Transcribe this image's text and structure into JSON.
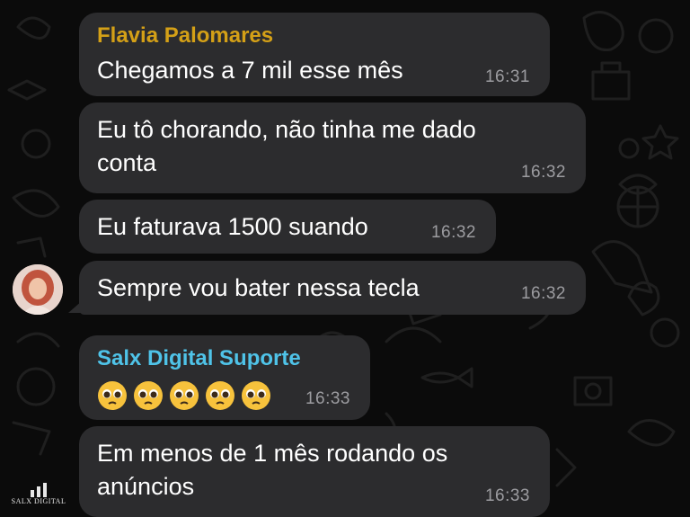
{
  "colors": {
    "background": "#0b0b0b",
    "bubble": "#2c2c2e",
    "sender_flavia": "#d4a017",
    "sender_salx": "#4fc3e8",
    "timestamp": "#9c9ca0"
  },
  "messages": [
    {
      "sender": "Flavia Palomares",
      "text": "Chegamos a 7 mil esse mês",
      "time": "16:31"
    },
    {
      "text": "Eu tô chorando, não tinha me dado\nconta",
      "time": "16:32"
    },
    {
      "text": "Eu faturava 1500 suando",
      "time": "16:32"
    },
    {
      "text": "Sempre vou bater nessa tecla",
      "time": "16:32"
    },
    {
      "sender": "Salx Digital Suporte",
      "emoji": "pleading-face-icon",
      "emoji_count": 5,
      "time": "16:33"
    },
    {
      "text": "Em menos de 1 mês rodando os\nanúncios",
      "time": "16:33"
    }
  ],
  "avatar": {
    "icon": "user-avatar-photo"
  },
  "logo": {
    "text": "SALX DIGITAL"
  }
}
